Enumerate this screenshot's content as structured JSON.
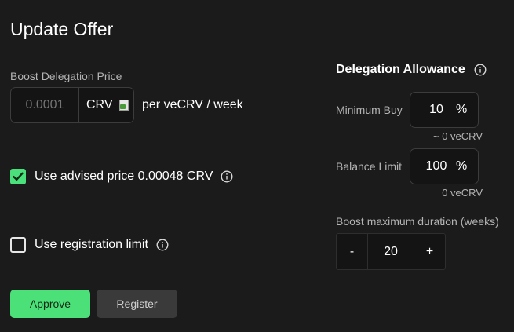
{
  "title": "Update Offer",
  "boost": {
    "label": "Boost Delegation Price",
    "price_placeholder": "0.0001",
    "price_value": "",
    "token_symbol": "CRV",
    "per_text": "per veCRV / week"
  },
  "advised": {
    "checked": true,
    "label": "Use advised price 0.00048 CRV"
  },
  "registration": {
    "checked": false,
    "label": "Use registration limit"
  },
  "buttons": {
    "approve": "Approve",
    "register": "Register"
  },
  "allowance": {
    "title": "Delegation Allowance",
    "min_buy": {
      "label": "Minimum Buy",
      "value": "10",
      "unit": "%",
      "note": "~ 0 veCRV"
    },
    "balance_limit": {
      "label": "Balance Limit",
      "value": "100",
      "unit": "%",
      "note": "0 veCRV"
    }
  },
  "duration": {
    "label": "Boost maximum duration (weeks)",
    "decrement": "-",
    "value": "20",
    "increment": "+"
  },
  "colors": {
    "accent": "#4be178",
    "background": "#1b1b1b",
    "muted": "#b4b4b4"
  },
  "icons": [
    "check-icon",
    "info-icon",
    "token-image-icon"
  ]
}
